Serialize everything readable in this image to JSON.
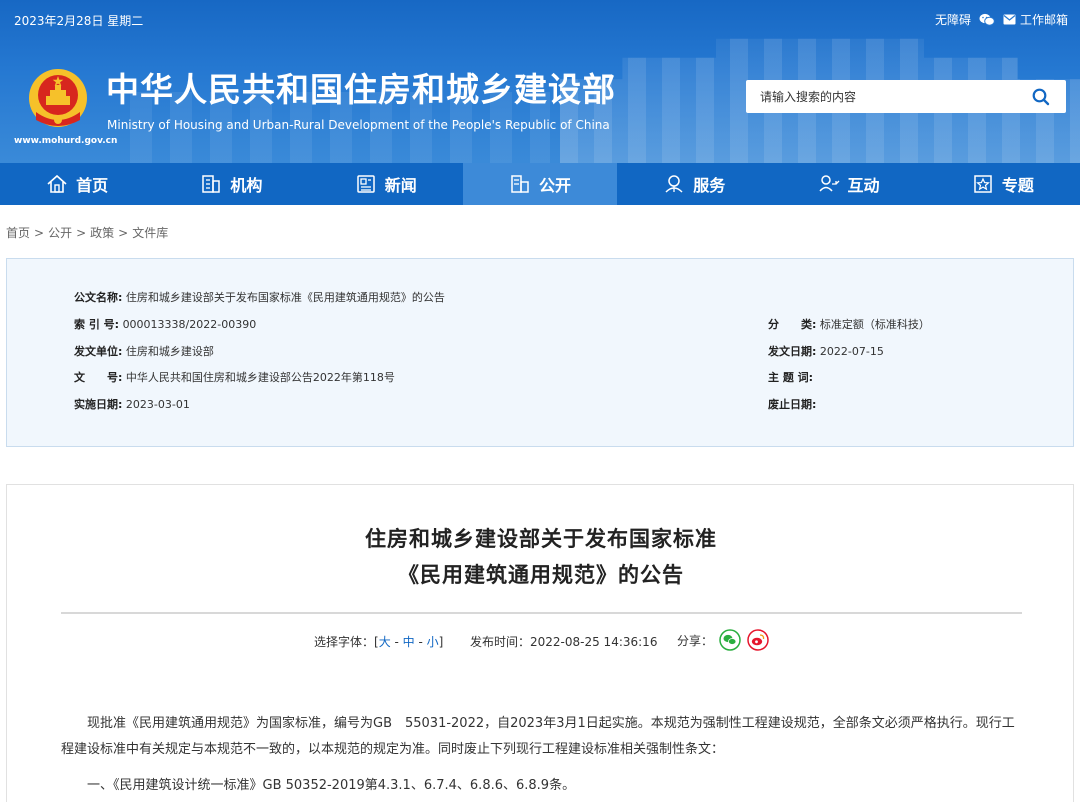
{
  "topbar": {
    "date": "2023年2月28日 星期二",
    "accessibility": "无障碍",
    "mail": "工作邮箱"
  },
  "site": {
    "title": "中华人民共和国住房和城乡建设部",
    "subtitle": "Ministry of Housing and Urban-Rural Development of the People's Republic of China",
    "url": "www.mohurd.gov.cn"
  },
  "search": {
    "placeholder": "请输入搜索的内容"
  },
  "nav": [
    {
      "label": "首页",
      "icon": "home-icon"
    },
    {
      "label": "机构",
      "icon": "building-icon"
    },
    {
      "label": "新闻",
      "icon": "news-icon"
    },
    {
      "label": "公开",
      "icon": "open-icon",
      "active": true
    },
    {
      "label": "服务",
      "icon": "service-icon"
    },
    {
      "label": "互动",
      "icon": "interact-icon"
    },
    {
      "label": "专题",
      "icon": "topic-icon"
    }
  ],
  "breadcrumb": [
    "首页",
    "公开",
    "政策",
    "文件库"
  ],
  "meta": {
    "doc_name_k": "公文名称:",
    "doc_name_v": "住房和城乡建设部关于发布国家标准《民用建筑通用规范》的公告",
    "index_k": "索 引 号:",
    "index_v": "000013338/2022-00390",
    "category_k": "分　　类:",
    "category_v": "标准定额（标准科技）",
    "issuer_k": "发文单位:",
    "issuer_v": "住房和城乡建设部",
    "issue_date_k": "发文日期:",
    "issue_date_v": "2022-07-15",
    "docno_k": "文　　号:",
    "docno_v": "中华人民共和国住房和城乡建设部公告2022年第118号",
    "subject_k": "主 题 词:",
    "subject_v": "",
    "effective_k": "实施日期:",
    "effective_v": "2023-03-01",
    "abolish_k": "废止日期:",
    "abolish_v": ""
  },
  "article": {
    "title_line1": "住房和城乡建设部关于发布国家标准",
    "title_line2": "《民用建筑通用规范》的公告",
    "font_label": "选择字体：[",
    "font_large": "大",
    "font_medium": "中",
    "font_small": "小",
    "font_close": "]",
    "pubtime": "发布时间：2022-08-25 14:36:16",
    "share_label": "分享：",
    "para1": "现批准《民用建筑通用规范》为国家标准，编号为GB　55031-2022，自2023年3月1日起实施。本规范为强制性工程建设规范，全部条文必须严格执行。现行工程建设标准中有关规定与本规范不一致的，以本规范的规定为准。同时废止下列现行工程建设标准相关强制性条文：",
    "item1": "一、《民用建筑设计统一标准》GB 50352-2019第4.3.1、6.7.4、6.8.6、6.8.9条。"
  },
  "colors": {
    "header_blue": "#1768c4",
    "nav_blue": "#1167c3",
    "nav_active": "#3d8ad8",
    "wechat_green": "#2aae3f",
    "weibo_red": "#e6162d"
  }
}
